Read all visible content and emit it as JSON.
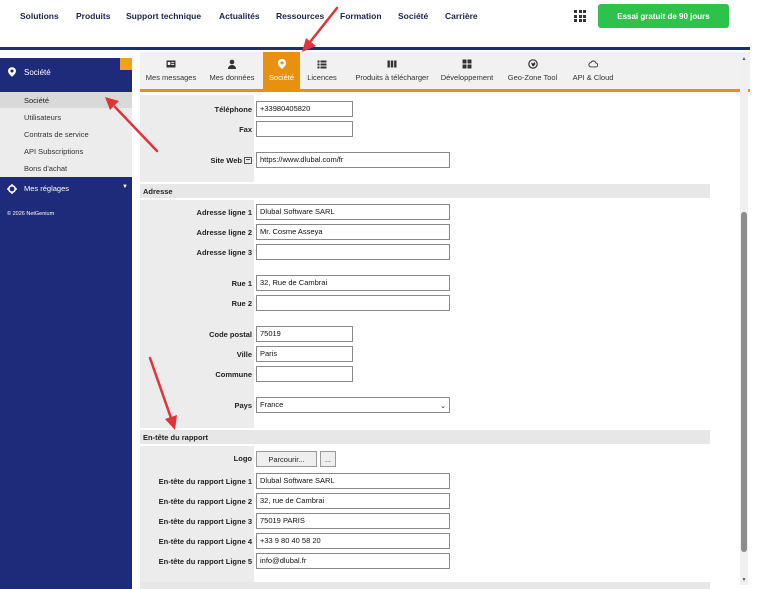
{
  "topnav": {
    "items": [
      "Solutions",
      "Produits",
      "Support technique",
      "Actualités",
      "Ressources",
      "Formation",
      "Société",
      "Carrière"
    ],
    "cta_label": "Essai gratuit de 90 jours"
  },
  "sidebar": {
    "header_label": "Société",
    "sub_items": [
      "Société",
      "Utilisateurs",
      "Contrats de service",
      "API Subscriptions",
      "Bons d'achat"
    ],
    "settings_label": "Mes réglages",
    "copyright": "© 2026 NetGenium"
  },
  "tabs": [
    {
      "label": "Mes messages",
      "icon": "id-card-icon"
    },
    {
      "label": "Mes données",
      "icon": "user-icon"
    },
    {
      "label": "Société",
      "icon": "location-pin-icon",
      "active": true
    },
    {
      "label": "Licences",
      "icon": "list-icon"
    },
    {
      "label": "Produits à télécharger",
      "icon": "bars-icon"
    },
    {
      "label": "Développement",
      "icon": "modules-icon"
    },
    {
      "label": "Geo-Zone Tool",
      "icon": "globe-icon"
    },
    {
      "label": "API & Cloud",
      "icon": "cloud-icon"
    }
  ],
  "form": {
    "telephone": {
      "label": "Téléphone",
      "value": "+33980405820"
    },
    "fax": {
      "label": "Fax",
      "value": ""
    },
    "website": {
      "label": "Site Web",
      "value": "https://www.dlubal.com/fr"
    },
    "address_section": "Adresse",
    "address1": {
      "label": "Adresse ligne 1",
      "value": "Dlubal Software SARL"
    },
    "address2": {
      "label": "Adresse ligne 2",
      "value": "Mr. Cosme Asseya"
    },
    "address3": {
      "label": "Adresse ligne 3",
      "value": ""
    },
    "street1": {
      "label": "Rue 1",
      "value": "32, Rue de Cambrai"
    },
    "street2": {
      "label": "Rue 2",
      "value": ""
    },
    "postal": {
      "label": "Code postal",
      "value": "75019"
    },
    "city": {
      "label": "Ville",
      "value": "Paris"
    },
    "commune": {
      "label": "Commune",
      "value": ""
    },
    "country": {
      "label": "Pays",
      "value": "France"
    },
    "report_section": "En-tête du rapport",
    "logo": {
      "label": "Logo",
      "browse": "Parcourir...",
      "more": "..."
    },
    "report1": {
      "label": "En-tête du rapport Ligne 1",
      "value": "Dlubal Software SARL"
    },
    "report2": {
      "label": "En-tête du rapport Ligne 2",
      "value": "32, rue de Cambrai"
    },
    "report3": {
      "label": "En-tête du rapport Ligne 3",
      "value": "75019 PARIS"
    },
    "report4": {
      "label": "En-tête du rapport Ligne 4",
      "value": "+33 9 80 40 58 20"
    },
    "report5": {
      "label": "En-tête du rapport Ligne 5",
      "value": "info@dlubal.fr"
    }
  },
  "colors": {
    "accent_orange": "#e8910f",
    "sidebar_blue": "#1e2a7a",
    "cta_green": "#2ec24a",
    "arrow_red": "#e0333a"
  }
}
